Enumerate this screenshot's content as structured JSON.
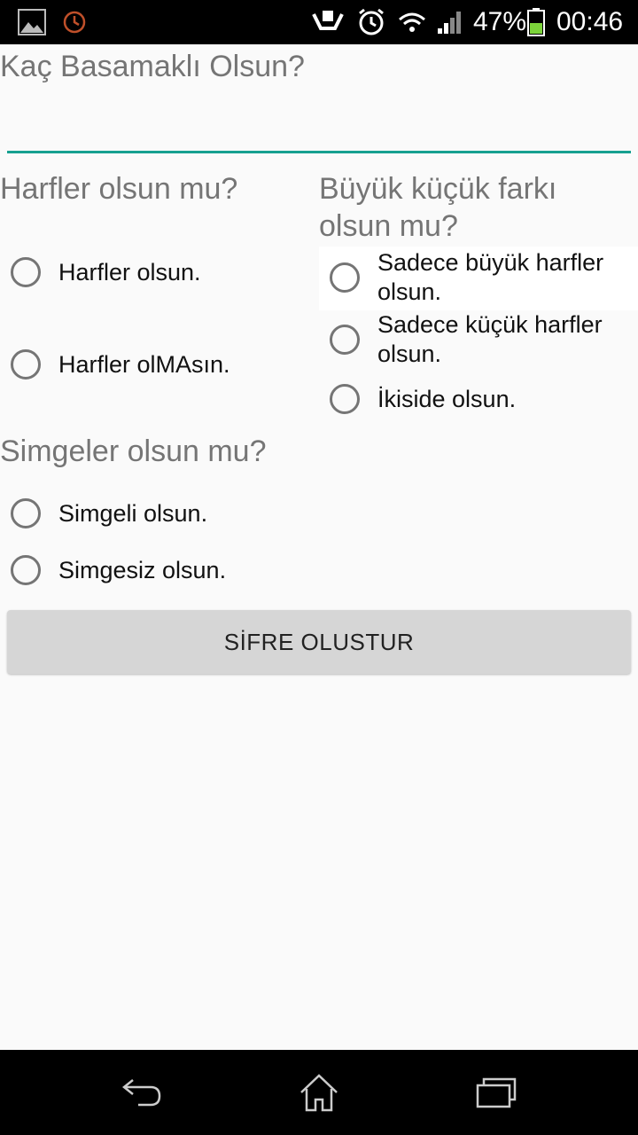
{
  "status_bar": {
    "battery_percent": "47%",
    "time": "00:46",
    "icons": [
      "image-icon",
      "alarm-clock-icon",
      "hands-icon",
      "alarm-icon",
      "wifi-icon",
      "signal-icon",
      "battery-icon"
    ]
  },
  "digits_section": {
    "label": "Kaç Basamaklı Olsun?",
    "input_value": ""
  },
  "letters_section": {
    "label": "Harfler olsun mu?",
    "options": [
      "Harfler olsun.",
      "Harfler olMAsın."
    ]
  },
  "case_section": {
    "label_line1": "Büyük küçük farkı",
    "label_line2": "olsun mu?",
    "options": [
      {
        "line1": "Sadece büyük harfler",
        "line2": "olsun."
      },
      {
        "line1": "Sadece küçük harfler",
        "line2": "olsun."
      },
      {
        "line1": "İkiside olsun.",
        "line2": ""
      }
    ]
  },
  "symbols_section": {
    "label": "Simgeler olsun mu?",
    "options": [
      "Simgeli olsun.",
      "Simgesiz olsun."
    ]
  },
  "generate_button_label": "SİFRE OLUSTUR",
  "colors": {
    "accent": "#16a090",
    "label_gray": "#757575",
    "button_bg": "#d6d6d6",
    "background": "#fafafa"
  },
  "nav_bar": {
    "icons": [
      "back-icon",
      "home-icon",
      "recents-icon"
    ]
  }
}
